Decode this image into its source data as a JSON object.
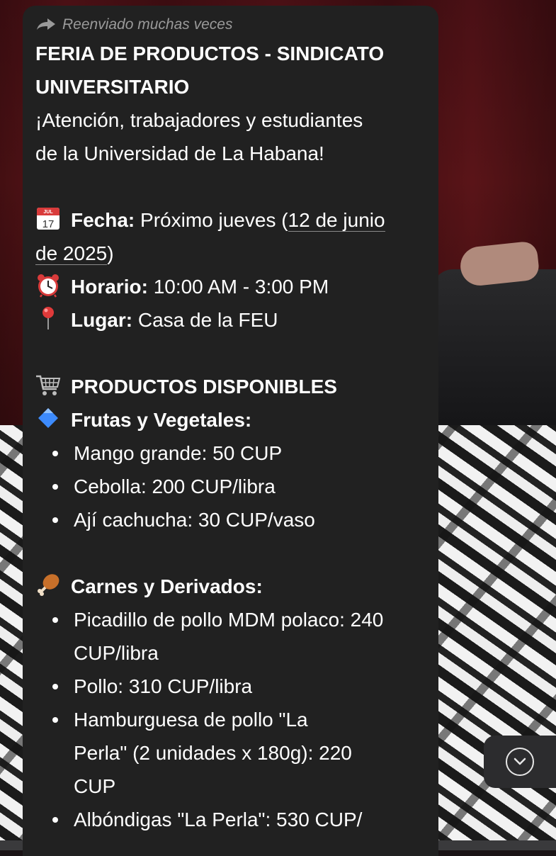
{
  "message": {
    "forwarded_label": "Reenviado muchas veces",
    "title_line1": "FERIA DE PRODUCTOS - SINDICATO",
    "title_line2": "UNIVERSITARIO",
    "intro_line1": "¡Atención, trabajadores y estudiantes",
    "intro_line2": "de la Universidad de La Habana!",
    "fecha": {
      "icon": "calendar-icon",
      "label": "Fecha:",
      "value_prefix": "Próximo jueves (",
      "date_link_part1": "12 de junio",
      "date_link_part2": "de 2025",
      "value_suffix": ")"
    },
    "horario": {
      "icon": "alarm-clock-icon",
      "label": "Horario:",
      "value": "10:00 AM - 3:00 PM"
    },
    "lugar": {
      "icon": "pin-icon",
      "label": "Lugar:",
      "value": "Casa de la FEU"
    },
    "products_heading": {
      "icon": "cart-icon",
      "text": "PRODUCTOS DISPONIBLES"
    },
    "section_frutas": {
      "icon": "blue-diamond-icon",
      "heading": "Frutas y Vegetales:",
      "items": [
        "Mango grande: 50 CUP",
        "Cebolla: 200 CUP/libra",
        "Ají cachucha: 30 CUP/vaso"
      ]
    },
    "section_carnes": {
      "icon": "poultry-leg-icon",
      "heading": "Carnes y Derivados:",
      "item1_line1": "Picadillo de pollo MDM polaco: 240",
      "item1_line2": "CUP/libra",
      "item2": "Pollo: 310 CUP/libra",
      "item3_line1": "Hamburguesa de pollo \"La",
      "item3_line2": "Perla\" (2 unidades x 180g): 220",
      "item3_line3": "CUP",
      "item4": "Albóndigas \"La Perla\": 530 CUP/"
    }
  },
  "scroll_button": {
    "icon": "chevron-down-circle-icon"
  }
}
